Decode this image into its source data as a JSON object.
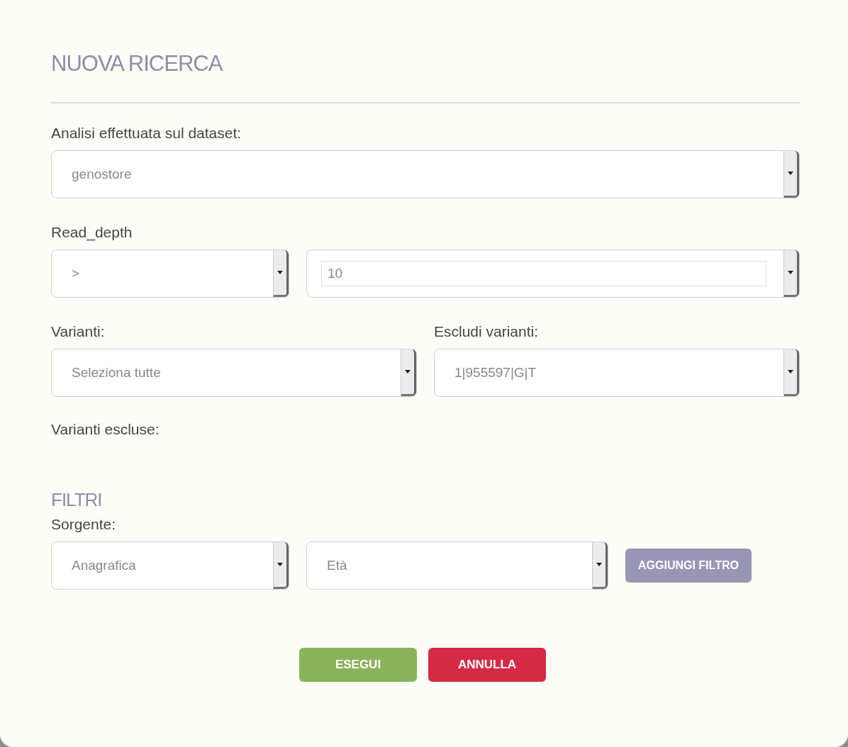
{
  "title": "NUOVA RICERCA",
  "dataset": {
    "label": "Analisi effettuata sul dataset:",
    "value": "genostore"
  },
  "read_depth": {
    "label": "Read_depth",
    "operator": ">",
    "value": "10"
  },
  "varianti": {
    "label": "Varianti:",
    "value": "Seleziona tutte"
  },
  "escludi_varianti": {
    "label": "Escludi varianti:",
    "value": "1|955597|G|T"
  },
  "varianti_escluse": {
    "label": "Varianti escluse:"
  },
  "filtri": {
    "title": "FILTRI",
    "source_label": "Sorgente:",
    "source": "Anagrafica",
    "field": "Età",
    "add_button": "AGGIUNGI FILTRO"
  },
  "buttons": [
    {
      "label": "ESEGUI",
      "kind": "primary"
    },
    {
      "label": "ANNULLA",
      "kind": "danger"
    }
  ]
}
